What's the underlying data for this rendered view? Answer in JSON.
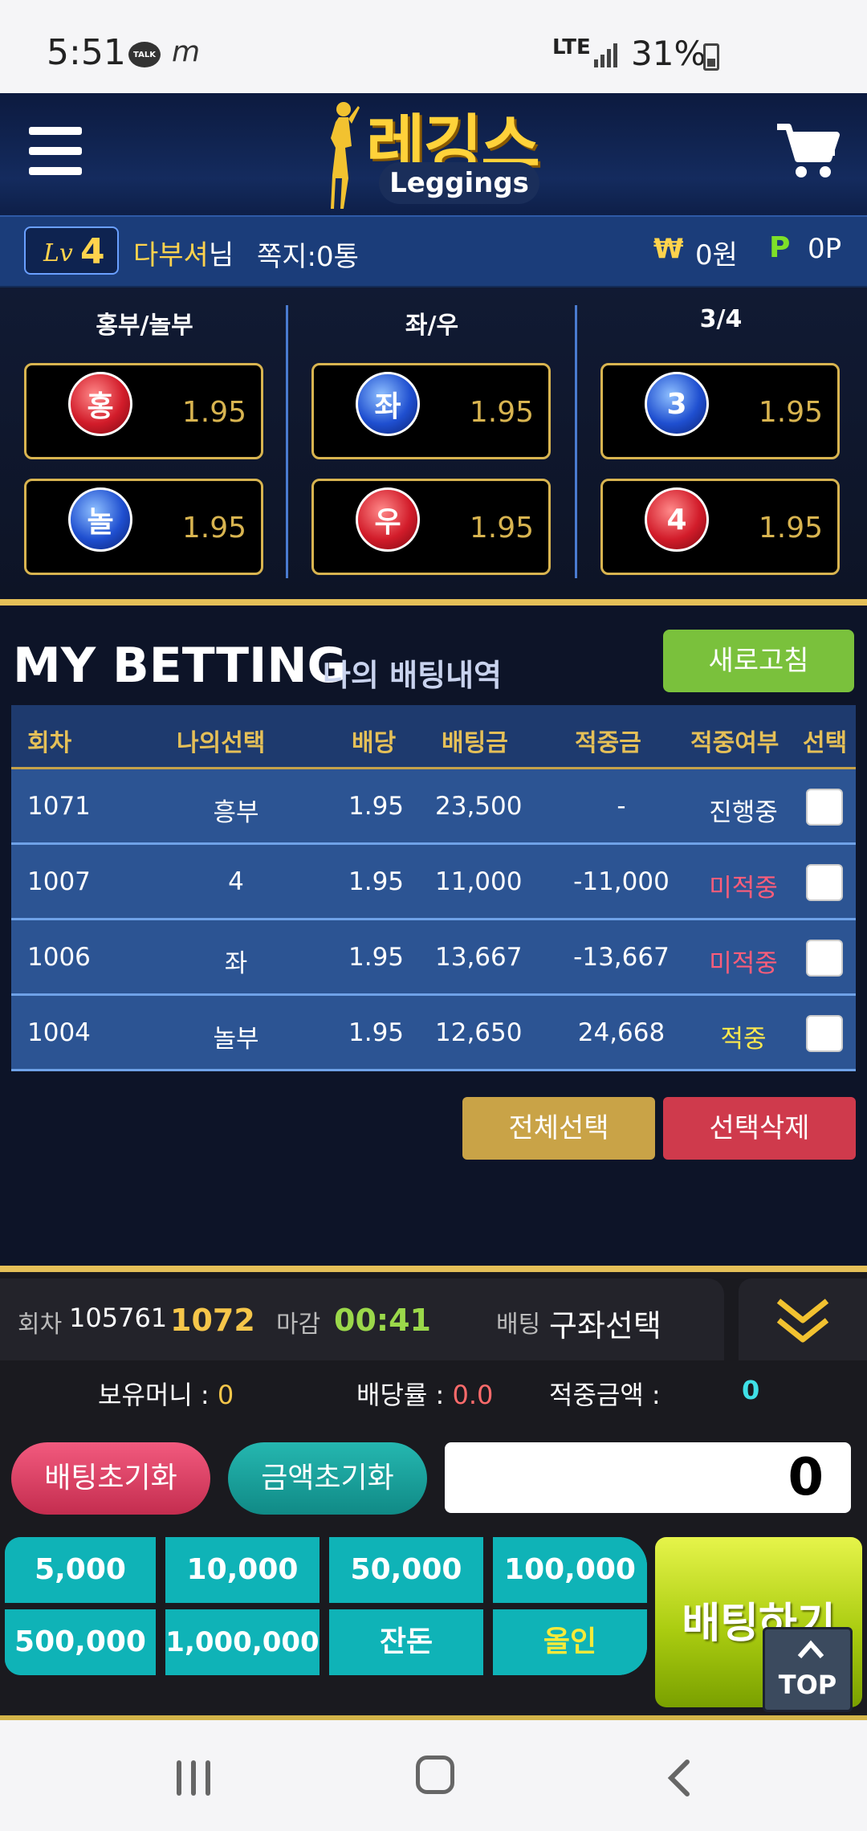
{
  "status_bar": {
    "time": "5:51",
    "talk_badge": "TALK",
    "app_icon": "m",
    "network": "LTE",
    "battery": "31%"
  },
  "header": {
    "logo_kr": "레깅스",
    "logo_en": "Leggings",
    "menu_icon": "hamburger-menu-icon",
    "cart_icon": "shopping-cart-icon"
  },
  "user_bar": {
    "level_prefix": "Lv",
    "level_num": "4",
    "name": "다부셔",
    "name_suffix": "님",
    "messages": "쪽지:0통",
    "won_symbol": "₩",
    "money": "0원",
    "point_symbol": "P",
    "points": "0P"
  },
  "game": {
    "columns": [
      {
        "title": "홍부/놀부",
        "options": [
          {
            "ball": "홍",
            "color": "red",
            "odds": "1.95"
          },
          {
            "ball": "놀",
            "color": "blue",
            "odds": "1.95"
          }
        ]
      },
      {
        "title": "좌/우",
        "options": [
          {
            "ball": "좌",
            "color": "blue",
            "odds": "1.95"
          },
          {
            "ball": "우",
            "color": "red",
            "odds": "1.95"
          }
        ]
      },
      {
        "title": "3/4",
        "options": [
          {
            "ball": "3",
            "color": "blue",
            "odds": "1.95"
          },
          {
            "ball": "4",
            "color": "red",
            "odds": "1.95"
          }
        ]
      }
    ]
  },
  "betting": {
    "title": "MY BETTING",
    "subtitle": "나의 배팅내역",
    "refresh_label": "새로고침",
    "headers": [
      "회차",
      "나의선택",
      "배당",
      "배팅금",
      "적중금",
      "적중여부",
      "선택"
    ],
    "rows": [
      {
        "round": "1071",
        "choice": "흥부",
        "odds": "1.95",
        "bet": "23,500",
        "win": "-",
        "status": "진행중",
        "status_color": "#ffffff"
      },
      {
        "round": "1007",
        "choice": "4",
        "odds": "1.95",
        "bet": "11,000",
        "win": "-11,000",
        "status": "미적중",
        "status_color": "#ff5d7a"
      },
      {
        "round": "1006",
        "choice": "좌",
        "odds": "1.95",
        "bet": "13,667",
        "win": "-13,667",
        "status": "미적중",
        "status_color": "#ff5d7a"
      },
      {
        "round": "1004",
        "choice": "놀부",
        "odds": "1.95",
        "bet": "12,650",
        "win": "24,668",
        "status": "적중",
        "status_color": "#ffe94d"
      }
    ],
    "select_all_label": "전체선택",
    "delete_selected_label": "선택삭제"
  },
  "slip": {
    "round_label": "회차",
    "round_total": "105761",
    "round_current": "1072",
    "deadline_label": "마감",
    "deadline": "00:41",
    "bet_label": "배팅",
    "bet_selection": "구좌선택",
    "balance_label": "보유머니 :",
    "balance": "0",
    "rate_label": "배당률 :",
    "rate": "0.0",
    "win_amount_label": "적중금액 :",
    "win_amount": "0",
    "reset_bet_label": "배팅초기화",
    "reset_amount_label": "금액초기화",
    "amount_value": "0",
    "chips": [
      "5,000",
      "10,000",
      "50,000",
      "100,000",
      "500,000",
      "1,000,000",
      "잔돈",
      "올인"
    ],
    "bet_button_label": "배팅하기",
    "top_label": "TOP"
  }
}
